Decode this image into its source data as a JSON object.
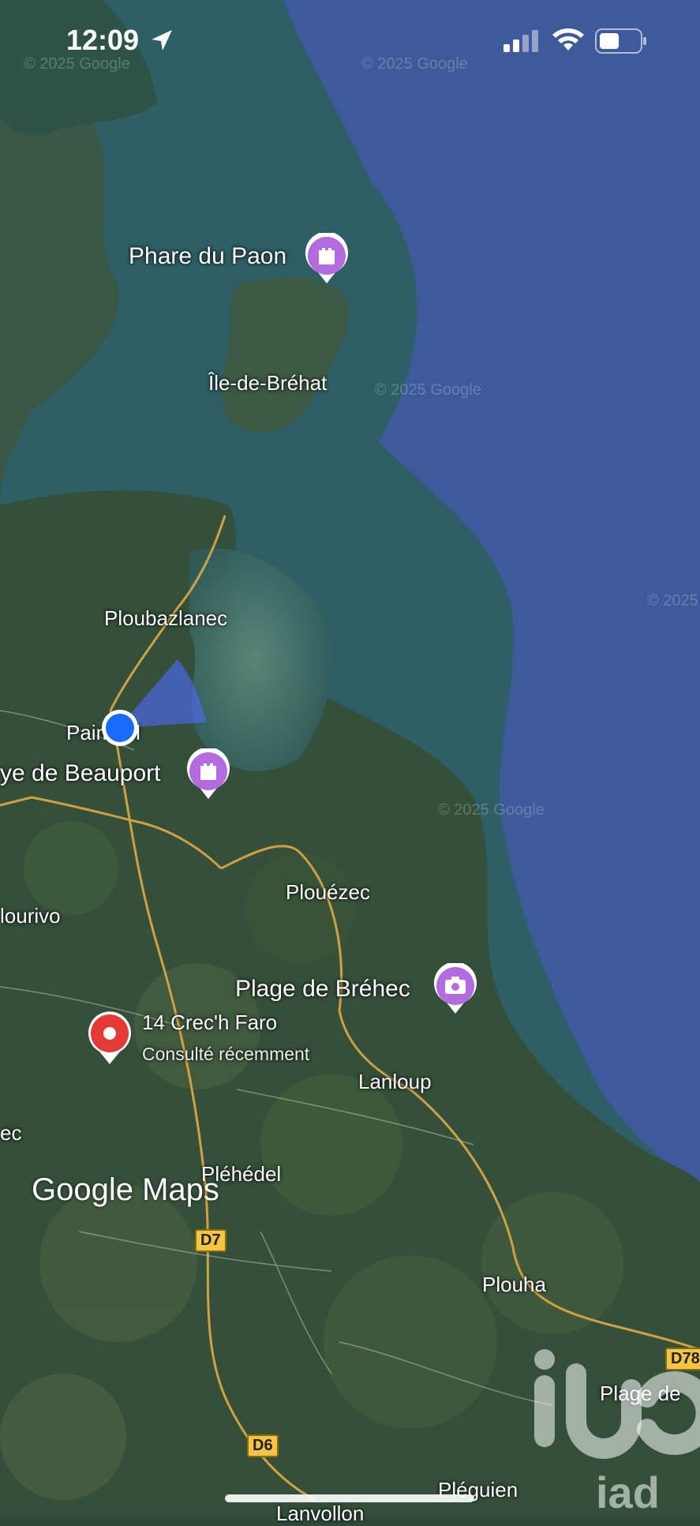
{
  "status_bar": {
    "time": "12:09"
  },
  "map": {
    "watermark": "© 2025 Google",
    "places": {
      "phare": "Phare du Paon",
      "brehat": "Île-de-Bréhat",
      "ploubazlanec": "Ploubazlanec",
      "paimpol": "Paimpol",
      "beauport": "ye de Beauport",
      "plouezec": "Plouézec",
      "plourivo": "lourivo",
      "brehec": "Plage de Bréhec",
      "lanloup": "Lanloup",
      "ec": "ec",
      "plehedel": "Pléhédel",
      "plouha": "Plouha",
      "plage_de": "Plage de",
      "pleguien": "Pléguien",
      "lanvollon": "Lanvollon"
    },
    "saved_place": {
      "title": "14 Crec'h Faro",
      "subtitle": "Consulté récemment"
    },
    "routes": {
      "d7": "D7",
      "d6": "D6",
      "d78": "D78"
    },
    "branding": "Google Maps",
    "overlay_logo": "iad",
    "colors": {
      "sea": "#3e5a9a",
      "land": "#2f4a34",
      "road": "#d9a441",
      "poi": "#b56be0",
      "pin": "#e53935",
      "location": "#1a6cff"
    }
  }
}
